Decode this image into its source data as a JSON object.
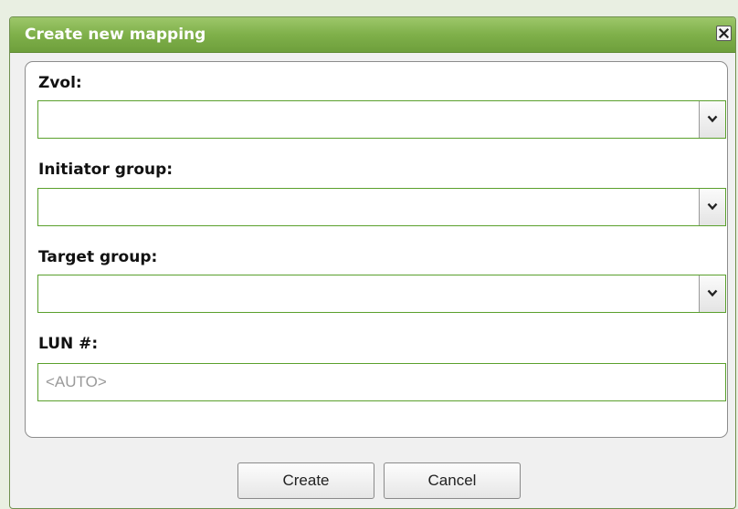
{
  "dialog": {
    "title": "Create new mapping",
    "close_icon": "close-icon"
  },
  "form": {
    "zvol": {
      "label": "Zvol:",
      "value": ""
    },
    "initiator_group": {
      "label": "Initiator group:",
      "value": ""
    },
    "target_group": {
      "label": "Target group:",
      "value": ""
    },
    "lun": {
      "label": "LUN #:",
      "value": "",
      "placeholder": "<AUTO>"
    }
  },
  "buttons": {
    "create": "Create",
    "cancel": "Cancel"
  },
  "colors": {
    "titlebar": "#7fb04a",
    "field_border": "#5aa02c",
    "title_text": "#ffffff"
  }
}
